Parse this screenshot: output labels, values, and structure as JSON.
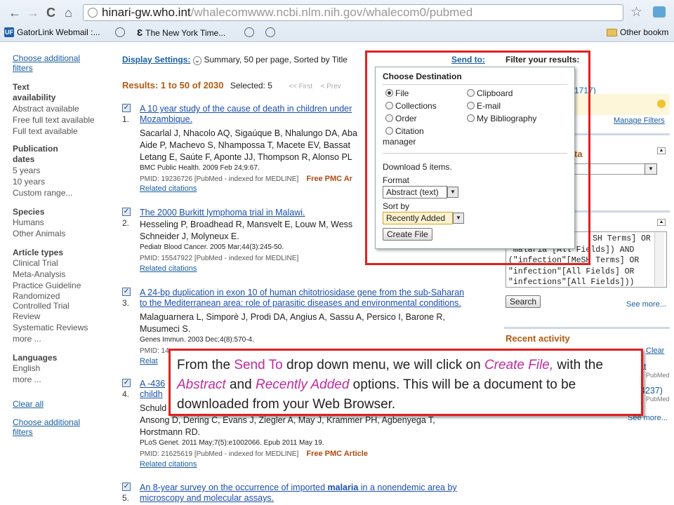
{
  "browser": {
    "url_host": "hinari-gw.who.int",
    "url_path": "/whalecomwww.ncbi.nlm.nih.gov/whalecom0/pubmed",
    "bookmarks": [
      {
        "label": "GatorLink Webmail :...",
        "icon": "uf-icon"
      },
      {
        "label": "",
        "icon": "globe-icon"
      },
      {
        "label": "The New York Time...",
        "icon": "nyt-icon"
      },
      {
        "label": "",
        "icon": "globe-icon"
      },
      {
        "label": "",
        "icon": "globe-icon"
      },
      {
        "label": "Other bookm",
        "icon": "folder-icon"
      }
    ]
  },
  "leftnav": {
    "choose_filters_top": "Choose additional filters",
    "text_avail_hd": "Text availability",
    "text_avail": [
      "Abstract available",
      "Free full text available",
      "Full text available"
    ],
    "pub_dates_hd": "Publication dates",
    "pub_dates": [
      "5 years",
      "10 years",
      "Custom range..."
    ],
    "species_hd": "Species",
    "species": [
      "Humans",
      "Other Animals"
    ],
    "article_types_hd": "Article types",
    "article_types": [
      "Clinical Trial",
      "Meta-Analysis",
      "Practice Guideline",
      "Randomized Controlled Trial",
      "Review",
      "Systematic Reviews",
      "more ..."
    ],
    "languages_hd": "Languages",
    "languages": [
      "English",
      "more ..."
    ],
    "clear_all": "Clear all",
    "choose_filters_bottom": "Choose additional filters"
  },
  "main": {
    "display_settings": "Display Settings:",
    "display_summary": "Summary, 50 per page, Sorted by Title",
    "send_to": "Send to:",
    "results": "Results: 1 to 50 of 2030",
    "selected": "Selected: 5",
    "first": "<< First",
    "prev": "< Prev",
    "items": [
      {
        "num": "1.",
        "title": "A 10 year study of the cause of death in children under",
        "title2": "Mozambique.",
        "authors": "Sacarlal J, Nhacolo AQ, Sigaúque B, Nhalungo DA, Aba",
        "authors2": "Aide P, Machevo S, Nhampossa T, Macete EV, Bassat",
        "authors3": "Letang E, Saúte F, Aponte JJ, Thompson R, Alonso PL",
        "journal": "BMC Public Health. 2009 Feb 24;9:67.",
        "pmid": "PMID: 19236726 [PubMed - indexed for MEDLINE]",
        "pmc": "Free PMC Ar",
        "related": "Related citations"
      },
      {
        "num": "2.",
        "title": "The 2000 Burkitt lymphoma trial in Malawi.",
        "authors": "Hesseling P, Broadhead R, Mansvelt E, Louw M, Wess",
        "authors2": "Schneider J, Molyneux E.",
        "journal": "Pediatr Blood Cancer. 2005 Mar;44(3):245-50.",
        "pmid": "PMID: 15547922 [PubMed - indexed for MEDLINE]",
        "related": "Related citations"
      },
      {
        "num": "3.",
        "title": "A 24-bp duplication in exon 10 of human chitotriosidase gene from the sub-Saharan",
        "title2": "to the Mediterranean area: role of parasitic diseases and environmental conditions.",
        "authors": "Malaguarnera L, Simporè J, Prodi DA, Angius A, Sassu A, Persico I, Barone R,",
        "authors2": "Musumeci S.",
        "journal": "Genes Immun. 2003 Dec;4(8):570-4.",
        "pmid": "PMID: 14",
        "related": "Relat"
      },
      {
        "num": "4.",
        "title": "A -436",
        "title2": "childh",
        "authors": "Schuld",
        "authors2": "Ansong D, Dering C, Evans J, Ziegler A, May J, Krammer PH, Agbenyega T,",
        "authors3": "Horstmann RD.",
        "journal": "PLoS Genet. 2011 May;7(5):e1002066. Epub 2011 May 19.",
        "pmid": "PMID: 21625619 [PubMed - indexed for MEDLINE]",
        "pmc": "Free PMC Article",
        "related": "Related citations"
      },
      {
        "num": "5.",
        "title_pre": "An 8-year survey on the occurrence of imported ",
        "title_bold": "malaria",
        "title_post": " in a nonendemic area by",
        "title2": "microscopy and molecular assays."
      }
    ]
  },
  "right": {
    "filter_title": "Filter your results:",
    "count_link": "1717)",
    "manage_filters": "Manage Filters",
    "search_details_hd": "ta",
    "query_lines": [
      "SH Terms] OR",
      "\"malaria\"[All Fields]) AND",
      "(\"infection\"[MeSH Terms] OR",
      "\"infection\"[All Fields] OR",
      "\"infections\"[All Fields]))"
    ],
    "search_btn": "Search",
    "see_more": "See more...",
    "recent_activity": "Recent activity",
    "clear": "Clear",
    "recent1": "at",
    "recent1_src": "PubMed",
    "recent2": "4237)",
    "recent2_src": "PubMed",
    "see_more2": "See more..."
  },
  "popup": {
    "title": "Choose Destination",
    "options": [
      "File",
      "Clipboard",
      "Collections",
      "E-mail",
      "Order",
      "My Bibliography",
      "Citation manager"
    ],
    "download": "Download 5 items.",
    "format_label": "Format",
    "format_value": "Abstract (text)",
    "sort_label": "Sort by",
    "sort_value": "Recently Added",
    "create_btn": "Create File"
  },
  "callout": {
    "p1": "From the ",
    "send_to": "Send To",
    "p2": " drop down menu, we will click on ",
    "create": "Create File,",
    "p3": " with the ",
    "abstract": "Abstract",
    "p4": " and ",
    "recently": "Recently Added",
    "p5": " options.  This will be a document to be downloaded from your Web Browser."
  }
}
